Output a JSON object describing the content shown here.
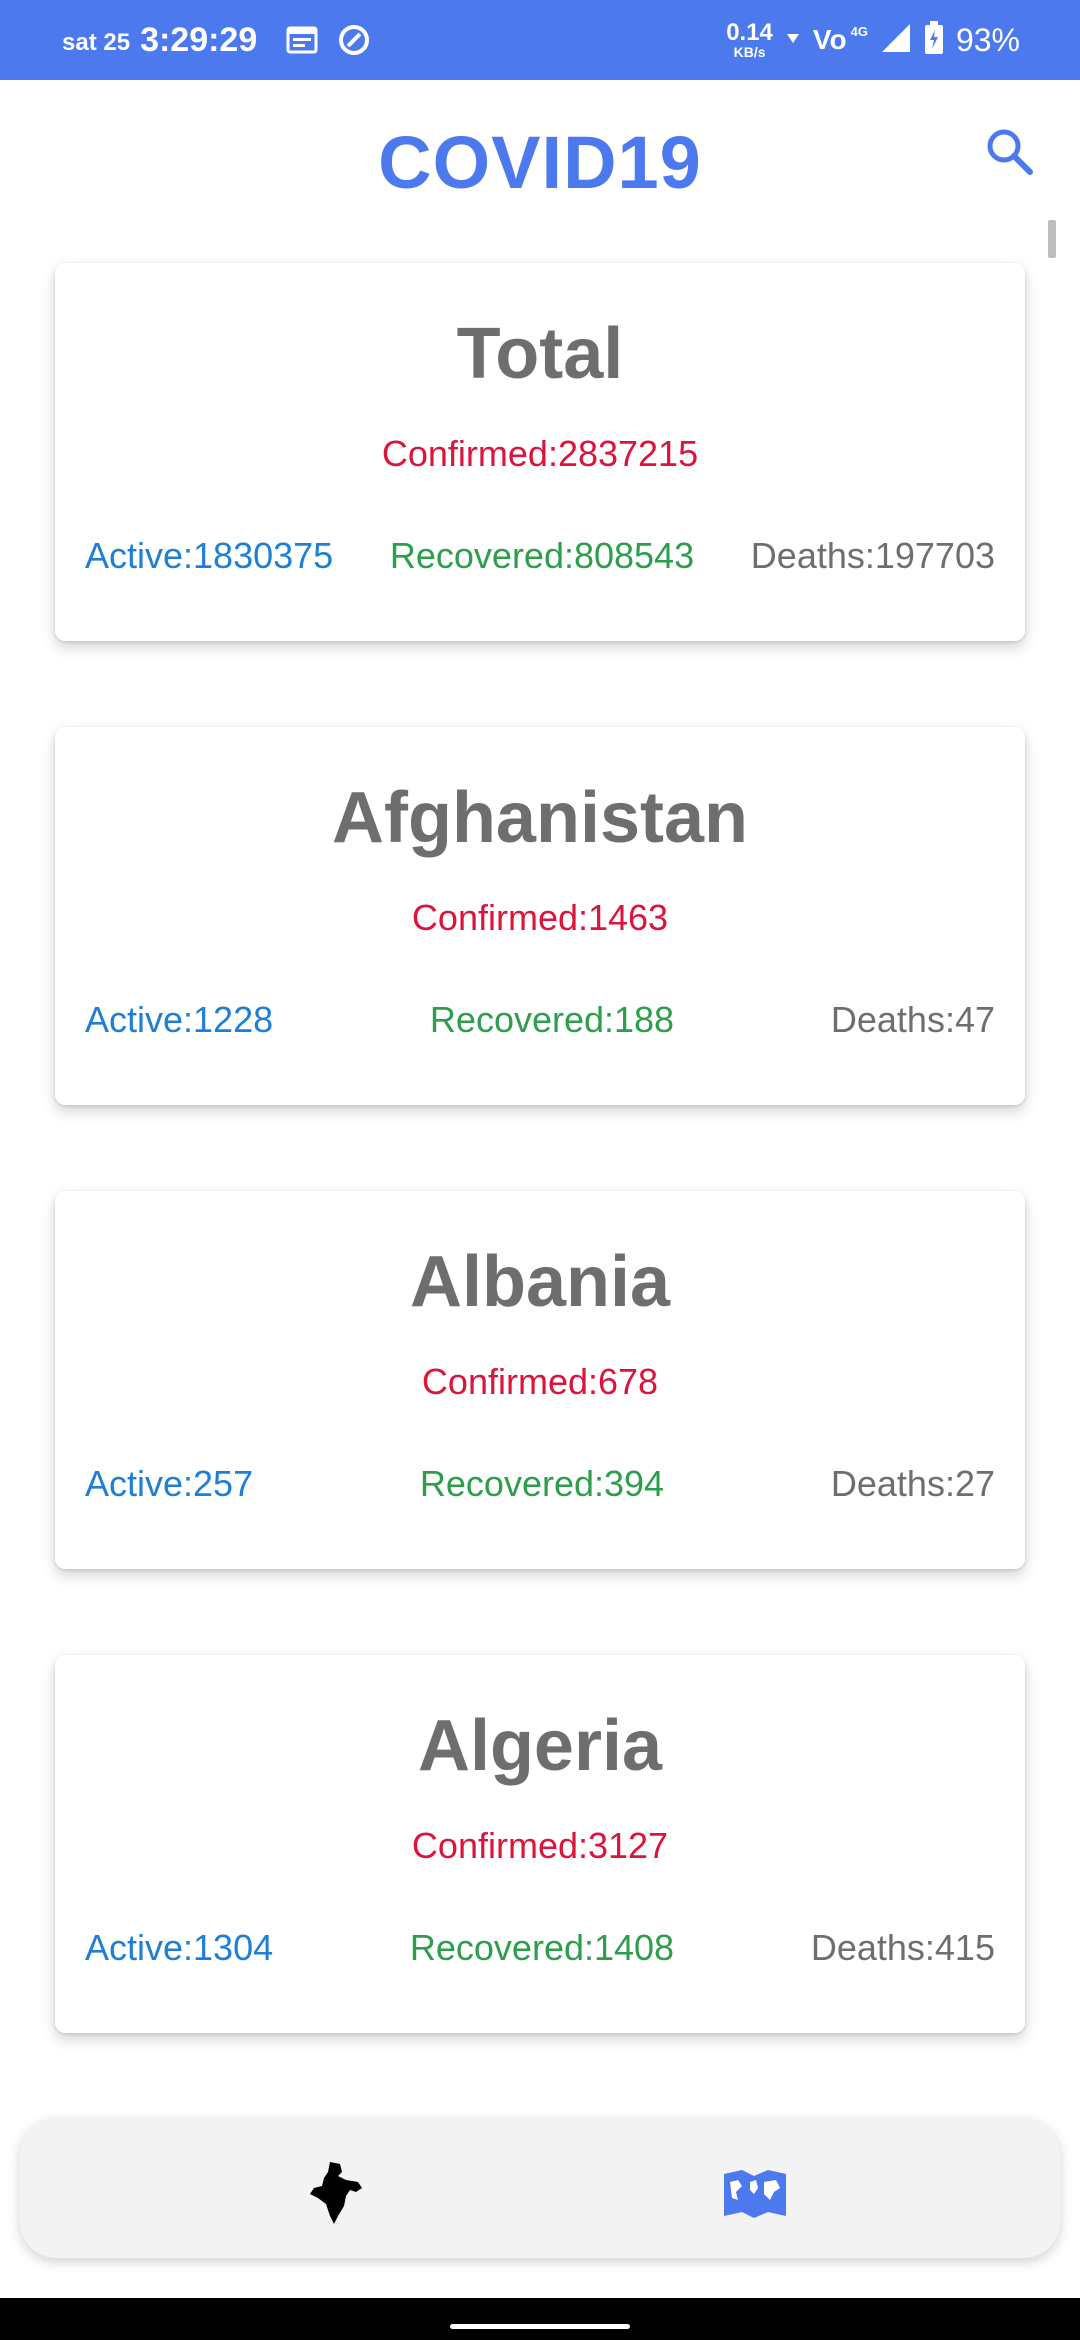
{
  "status_bar": {
    "day": "sat 25",
    "time": "3:29:29",
    "net_speed_value": "0.14",
    "net_speed_unit": "KB/s",
    "carrier_label": "Vo",
    "network_type": "4G",
    "battery": "93%"
  },
  "header": {
    "title": "COVID19",
    "search_icon": "search-icon"
  },
  "cards": [
    {
      "title": "Total",
      "confirmed": "Confirmed:2837215",
      "active": "Active:1830375",
      "recovered": "Recovered:808543",
      "deaths": "Deaths:197703"
    },
    {
      "title": "Afghanistan",
      "confirmed": "Confirmed:1463",
      "active": "Active:1228",
      "recovered": "Recovered:188",
      "deaths": "Deaths:47"
    },
    {
      "title": "Albania",
      "confirmed": "Confirmed:678",
      "active": "Active:257",
      "recovered": "Recovered:394",
      "deaths": "Deaths:27"
    },
    {
      "title": "Algeria",
      "confirmed": "Confirmed:3127",
      "active": "Active:1304",
      "recovered": "Recovered:1408",
      "deaths": "Deaths:415"
    }
  ],
  "bottom_nav": {
    "items": [
      {
        "icon": "india-map-icon"
      },
      {
        "icon": "world-map-icon"
      }
    ]
  },
  "colors": {
    "accent": "#4d79ee",
    "confirmed": "#dc143c",
    "active": "#1f7fd6",
    "recovered": "#2e9e4c",
    "deaths": "#6e6e6e"
  }
}
